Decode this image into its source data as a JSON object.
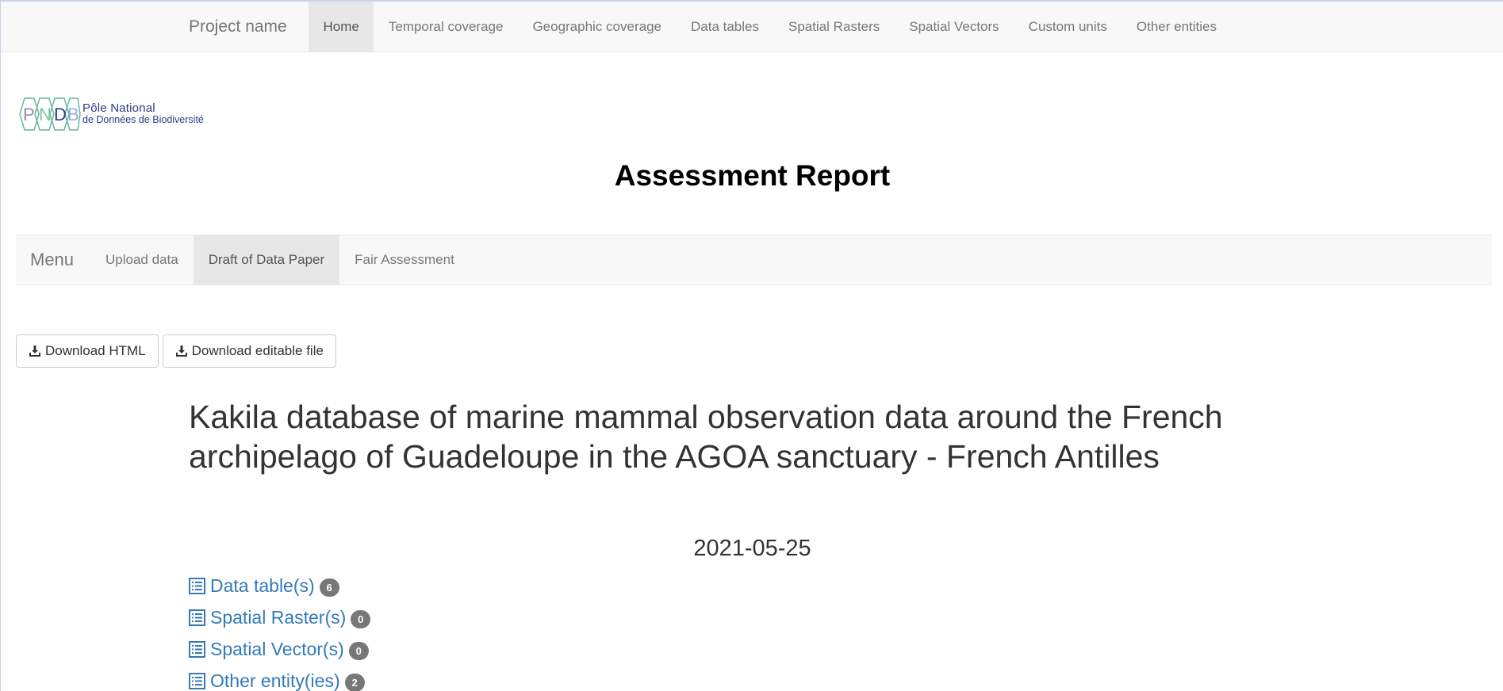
{
  "topnav": {
    "brand": "Project name",
    "items": [
      {
        "label": "Home",
        "active": true
      },
      {
        "label": "Temporal coverage"
      },
      {
        "label": "Geographic coverage"
      },
      {
        "label": "Data tables"
      },
      {
        "label": "Spatial Rasters"
      },
      {
        "label": "Spatial Vectors"
      },
      {
        "label": "Custom units"
      },
      {
        "label": "Other entities"
      }
    ]
  },
  "logo": {
    "letters": [
      "P",
      "N",
      "D",
      "B"
    ],
    "line1": "Pôle National",
    "line2": "de Données de Biodiversité"
  },
  "report_title": "Assessment Report",
  "subnav": {
    "brand": "Menu",
    "items": [
      {
        "label": "Upload data"
      },
      {
        "label": "Draft of Data Paper",
        "active": true
      },
      {
        "label": "Fair Assessment"
      }
    ]
  },
  "buttons": {
    "download_html": "Download HTML",
    "download_editable": "Download editable file"
  },
  "paper": {
    "title": "Kakila database of marine mammal observation data around the French archipelago of Guadeloupe in the AGOA sanctuary - French Antilles",
    "date": "2021-05-25",
    "links": [
      {
        "label": "Data table(s)",
        "count": "6"
      },
      {
        "label": "Spatial Raster(s)",
        "count": "0"
      },
      {
        "label": "Spatial Vector(s)",
        "count": "0"
      },
      {
        "label": "Other entity(ies)",
        "count": "2"
      }
    ]
  },
  "colors": {
    "link": "#337ab7",
    "badge": "#777777",
    "navbar_bg": "#f8f8f8",
    "navbar_active": "#e7e7e7"
  }
}
